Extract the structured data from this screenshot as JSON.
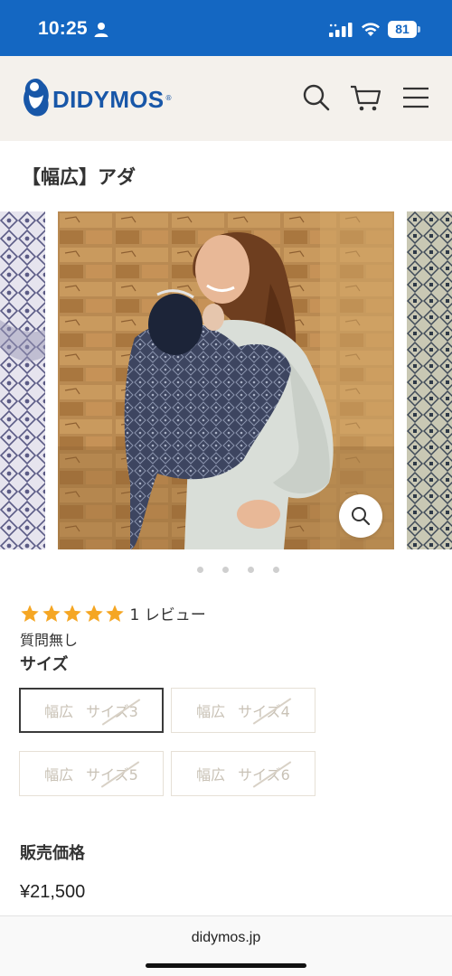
{
  "status_bar": {
    "time": "10:25",
    "battery": "81",
    "background_color": "#1467c2"
  },
  "header": {
    "logo_text": "DIDYMOS",
    "logo_reg": "®",
    "brand_color": "#1857a8",
    "icons": [
      "search-icon",
      "cart-icon",
      "menu-icon"
    ]
  },
  "product": {
    "title": "【幅広】アダ",
    "rating_stars": 5,
    "review_count_label": "1 レビュー",
    "qa_label": "質問無し",
    "size_heading": "サイズ",
    "sizes": [
      {
        "prefix": "幅広",
        "label": "サイズ3",
        "selected": true,
        "available": false
      },
      {
        "prefix": "幅広",
        "label": "サイズ4",
        "selected": false,
        "available": false
      },
      {
        "prefix": "幅広",
        "label": "サイズ5",
        "selected": false,
        "available": false
      },
      {
        "prefix": "幅広",
        "label": "サイズ6",
        "selected": false,
        "available": false
      }
    ],
    "price_label": "販売価格",
    "price": "¥21,500",
    "star_color": "#f5a623"
  },
  "gallery": {
    "slide_count": 4,
    "active_index": 1
  },
  "browser": {
    "url": "didymos.jp"
  }
}
